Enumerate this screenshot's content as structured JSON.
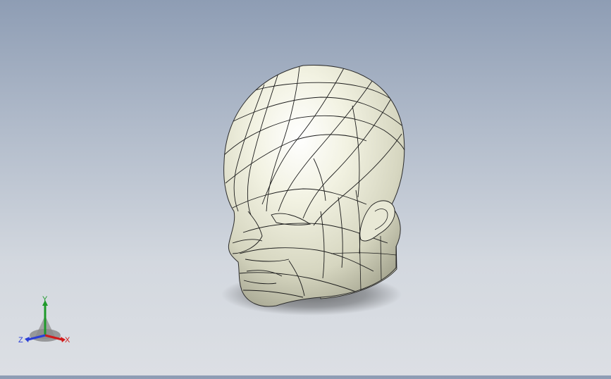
{
  "viewport": {
    "background_top": "#8e9db4",
    "background_bottom": "#dcdfe4",
    "model": "head-model",
    "model_surface_color": "#eeeedd",
    "mesh_line_color": "#1b1b1b"
  },
  "triad": {
    "x_label": "X",
    "y_label": "Y",
    "z_label": "Z",
    "x_color": "#d11b1b",
    "y_color": "#1e9a2a",
    "z_color": "#2b3fd6"
  }
}
